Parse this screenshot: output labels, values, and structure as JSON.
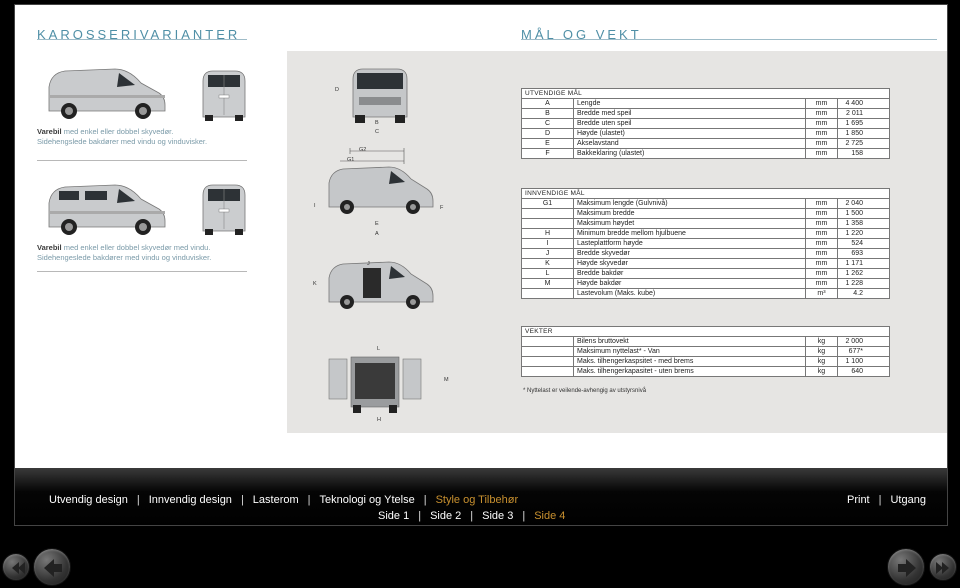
{
  "left_title": "KAROSSERIVARIANTER",
  "right_title": "MÅL OG VEKT",
  "variants": [
    {
      "strong": "Varebil",
      "text": " med enkel eller dobbel skyvedør.",
      "line2": "Sidehengslede bakdører med vindu og vinduvisker."
    },
    {
      "strong": "Varebil",
      "text": " med enkel eller dobbel skyvedør med vindu.",
      "line2": "Sidehengeslede bakdører med vindu og vinduvisker."
    }
  ],
  "dim_labels": {
    "D": "D",
    "B": "B",
    "C": "C",
    "G2": "G2",
    "G1": "G1",
    "I": "I",
    "F": "F",
    "E": "E",
    "A": "A",
    "J": "J",
    "K": "K",
    "L": "L",
    "M": "M",
    "H": "H"
  },
  "exterior": {
    "header": "UTVENDIGE MÅL",
    "rows": [
      {
        "code": "A",
        "label": "Lengde",
        "unit": "mm",
        "value": "4 400"
      },
      {
        "code": "B",
        "label": "Bredde med speil",
        "unit": "mm",
        "value": "2 011"
      },
      {
        "code": "C",
        "label": "Bredde uten speil",
        "unit": "mm",
        "value": "1 695"
      },
      {
        "code": "D",
        "label": "Høyde (ulastet)",
        "unit": "mm",
        "value": "1 850"
      },
      {
        "code": "E",
        "label": "Akselavstand",
        "unit": "mm",
        "value": "2 725"
      },
      {
        "code": "F",
        "label": "Bakkeklaring (ulastet)",
        "unit": "mm",
        "value": "158"
      }
    ]
  },
  "interior": {
    "header": "INNVENDIGE MÅL",
    "rows": [
      {
        "code": "G1",
        "label": "Maksimum lengde (Gulvnivå)",
        "unit": "mm",
        "value": "2 040"
      },
      {
        "code": "",
        "label": "Maksimum bredde",
        "unit": "mm",
        "value": "1 500"
      },
      {
        "code": "",
        "label": "Maksimum høydet",
        "unit": "mm",
        "value": "1 358"
      },
      {
        "code": "H",
        "label": "Minimum bredde mellom hjulbuene",
        "unit": "mm",
        "value": "1 220"
      },
      {
        "code": "I",
        "label": "Lasteplattform høyde",
        "unit": "mm",
        "value": "524"
      },
      {
        "code": "J",
        "label": "Bredde skyvedør",
        "unit": "mm",
        "value": "693"
      },
      {
        "code": "K",
        "label": "Høyde skyvedør",
        "unit": "mm",
        "value": "1 171"
      },
      {
        "code": "L",
        "label": "Bredde bakdør",
        "unit": "mm",
        "value": "1 262"
      },
      {
        "code": "M",
        "label": "Høyde bakdør",
        "unit": "mm",
        "value": "1 228"
      },
      {
        "code": "",
        "label": "Lastevolum (Maks. kube)",
        "unit": "m³",
        "value": "4.2"
      }
    ]
  },
  "weights": {
    "header": "VEKTER",
    "rows": [
      {
        "code": "",
        "label": "Bilens bruttovekt",
        "unit": "kg",
        "value": "2 000"
      },
      {
        "code": "",
        "label": "Maksimum nyttelast* - Van",
        "unit": "kg",
        "value": "677*"
      },
      {
        "code": "",
        "label": "Maks. tilhengerkaspsitet - med brems",
        "unit": "kg",
        "value": "1 100"
      },
      {
        "code": "",
        "label": "Maks. tilhengerkapasitet - uten brems",
        "unit": "kg",
        "value": "640"
      }
    ],
    "footnote": "* Nyttelast er veilende-avhengig av utstyrsnivå"
  },
  "nav_main": [
    {
      "label": "Utvendig design",
      "active": false
    },
    {
      "label": "Innvendig design",
      "active": false
    },
    {
      "label": "Lasterom",
      "active": false
    },
    {
      "label": "Teknologi og Ytelse",
      "active": false
    },
    {
      "label": "Style og Tilbehør",
      "active": true
    }
  ],
  "nav_pages": [
    {
      "label": "Side 1",
      "active": false
    },
    {
      "label": "Side 2",
      "active": false
    },
    {
      "label": "Side 3",
      "active": false
    },
    {
      "label": "Side 4",
      "active": true
    }
  ],
  "nav_right": [
    "Print",
    "Utgang"
  ],
  "colors": {
    "accent": "#4f8fa6",
    "active_nav": "#c8902f"
  }
}
